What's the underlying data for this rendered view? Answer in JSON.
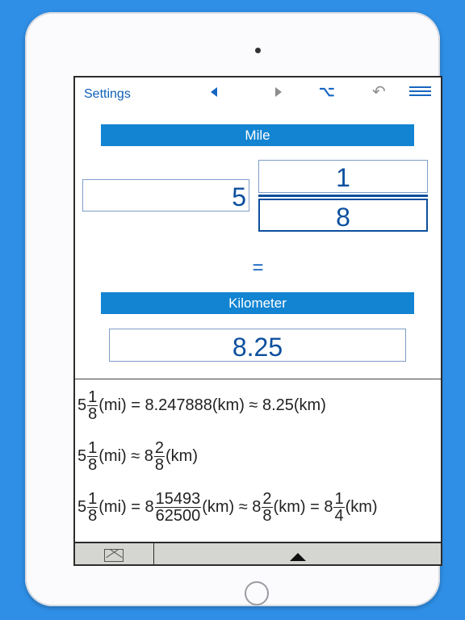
{
  "toolbar": {
    "settings_label": "Settings",
    "option_symbol": "⌥",
    "undo_symbol": "↶"
  },
  "converter": {
    "from_unit": "Mile",
    "whole": "5",
    "numerator": "1",
    "denominator": "8",
    "equals": "=",
    "to_unit": "Kilometer",
    "result": "8.25"
  },
  "results": {
    "line1": {
      "whole": "5",
      "num": "1",
      "den": "8",
      "mid": "(mi) = 8.247888(km) ≈ 8.25(km)"
    },
    "line2": {
      "whole": "5",
      "num": "1",
      "den": "8",
      "mid": "(mi) ≈ 8",
      "num2": "2",
      "den2": "8",
      "end": "(km)"
    },
    "line3": {
      "whole": "5",
      "num": "1",
      "den": "8",
      "a": "(mi) = 8",
      "num2": "15493",
      "den2": "62500",
      "b": "(km) ≈ 8",
      "num3": "2",
      "den3": "8",
      "c": "(km) = 8",
      "num4": "1",
      "den4": "4",
      "d": "(km)"
    }
  },
  "colors": {
    "accent": "#1384d2",
    "background": "#2f8fe6"
  }
}
